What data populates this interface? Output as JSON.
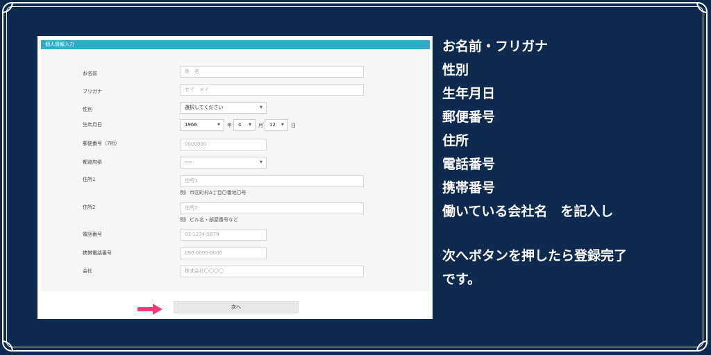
{
  "form": {
    "section_title": "個人情報入力",
    "fields": {
      "name": {
        "label": "お名前",
        "placeholder": "姓　名"
      },
      "furigana": {
        "label": "フリガナ",
        "placeholder": "セイ　メイ"
      },
      "gender": {
        "label": "性別",
        "value": "選択してください"
      },
      "birthdate": {
        "label": "生年月日",
        "year": "1966",
        "year_unit": "年",
        "month": "4",
        "month_unit": "月",
        "day": "12",
        "day_unit": "日"
      },
      "postal": {
        "label": "郵便番号（7桁）",
        "placeholder": "0000000"
      },
      "prefecture": {
        "label": "都道府県",
        "value": "----"
      },
      "address1": {
        "label": "住所1",
        "placeholder": "住所1",
        "hint": "例）市区町村Δ丁目〇番地〇号"
      },
      "address2": {
        "label": "住所2",
        "placeholder": "住所2",
        "hint": "例）ビル名・部屋番号など"
      },
      "phone": {
        "label": "電話番号",
        "placeholder": "03-1234-5678"
      },
      "mobile": {
        "label": "携帯電話番号",
        "placeholder": "090-0000-0000"
      },
      "company": {
        "label": "会社",
        "placeholder": "株式会社〇〇〇〇"
      }
    },
    "next_button": "次へ",
    "arrow_color": "#e83e76"
  },
  "notes": {
    "lines": [
      "お名前・フリガナ",
      "性別",
      "生年月日",
      "郵便番号",
      "住所",
      "電話番号",
      "携帯番号",
      "働いている会社名　を記入し"
    ],
    "lines2": [
      "次へボタンを押したら登録完了",
      "です。"
    ]
  },
  "colors": {
    "background": "#0e2a4f",
    "header": "#36a9c9"
  }
}
